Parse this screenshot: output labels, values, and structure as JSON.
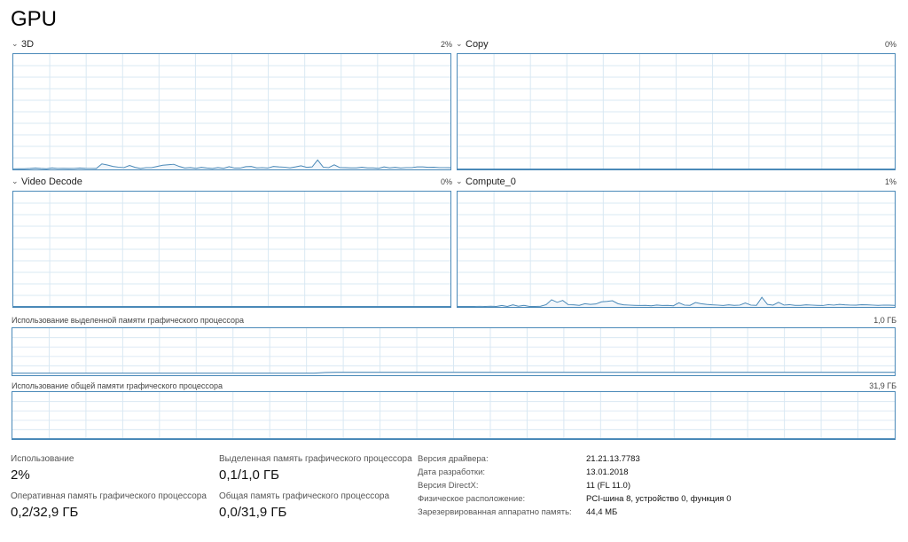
{
  "title": "GPU",
  "engines": [
    {
      "label": "3D",
      "pct": "2%",
      "values": [
        0.5,
        0.6,
        0.6,
        0.8,
        1.2,
        0.8,
        0.6,
        1.4,
        0.9,
        1.0,
        0.8,
        0.9,
        1.2,
        1.0,
        0.9,
        0.8,
        4.8,
        3.9,
        2.6,
        2.0,
        1.6,
        3.4,
        1.8,
        0.9,
        1.6,
        1.6,
        2.6,
        3.6,
        4.0,
        4.5,
        2.6,
        1.3,
        1.6,
        1.0,
        1.8,
        1.3,
        0.9,
        1.6,
        1.0,
        2.4,
        1.2,
        1.2,
        2.4,
        2.6,
        1.4,
        1.6,
        1.2,
        2.6,
        2.2,
        2.0,
        1.4,
        2.2,
        3.2,
        1.8,
        2.2,
        8.2,
        2.0,
        1.6,
        4.0,
        1.6,
        1.5,
        1.4,
        1.4,
        1.9,
        1.4,
        1.4,
        1.0,
        2.2,
        1.4,
        1.8,
        1.2,
        1.6,
        1.6,
        2.2,
        2.2,
        1.8,
        1.9,
        1.6,
        1.6,
        1.5
      ]
    },
    {
      "label": "Copy",
      "pct": "0%",
      "values": [
        0.1,
        0.1,
        0.1,
        0.1,
        0.1,
        0.1,
        0.1,
        0.1,
        0.2,
        0.1,
        0.1,
        0.1,
        0.1,
        0.1,
        0.1,
        0.1,
        0.1,
        0.1,
        0.1,
        0.1,
        0.1,
        0.1,
        0.1,
        0.1,
        0.1,
        0.1,
        0.1,
        0.1,
        0.1,
        0.1,
        0.1,
        0.1,
        0.1,
        0.1,
        0.1,
        0.1,
        0.1,
        0.1,
        0.1,
        0.1,
        0.1,
        0.1,
        0.1,
        0.1,
        0.1,
        0.1,
        0.1,
        0.1,
        0.1,
        0.1,
        0.1,
        0.1,
        0.1,
        0.1,
        0.1,
        0.1,
        0.1,
        0.1,
        0.1,
        0.1,
        0.1,
        0.2,
        0.1,
        0.1,
        0.1,
        0.1,
        0.1,
        0.1,
        0.1,
        0.1,
        0.1,
        0.1,
        0.1,
        0.1,
        0.1,
        0.1,
        0.1,
        0.1,
        0.1,
        0.1
      ]
    },
    {
      "label": "Video Decode",
      "pct": "0%",
      "values": [
        0,
        0,
        0,
        0,
        0,
        0,
        0,
        0,
        0,
        0,
        0,
        0,
        0,
        0,
        0,
        0,
        0,
        0,
        0,
        0,
        0,
        0,
        0,
        0,
        0,
        0,
        0,
        0,
        0,
        0,
        0,
        0,
        0,
        0,
        0,
        0,
        0,
        0,
        0,
        0,
        0,
        0,
        0,
        0,
        0,
        0,
        0,
        0,
        0,
        0,
        0,
        0,
        0,
        0,
        0,
        0,
        0,
        0,
        0,
        0,
        0,
        0,
        0,
        0,
        0,
        0,
        0,
        0,
        0,
        0,
        0,
        0,
        0,
        0,
        0,
        0,
        0,
        0,
        0,
        0
      ]
    },
    {
      "label": "Compute_0",
      "pct": "1%",
      "values": [
        0.3,
        0.4,
        0.3,
        0.4,
        0.5,
        0.3,
        0.6,
        0.3,
        1.2,
        0.4,
        1.8,
        0.6,
        1.4,
        0.4,
        0.4,
        0.6,
        2.0,
        6.2,
        4.0,
        5.6,
        2.0,
        1.8,
        1.4,
        2.8,
        2.2,
        2.6,
        4.4,
        4.8,
        5.4,
        2.8,
        1.8,
        1.6,
        1.4,
        1.2,
        1.4,
        1.0,
        1.6,
        1.2,
        1.4,
        1.0,
        3.6,
        1.6,
        1.4,
        3.8,
        2.8,
        2.2,
        1.8,
        1.6,
        1.2,
        1.8,
        1.4,
        1.6,
        3.4,
        1.6,
        1.4,
        8.4,
        2.2,
        1.6,
        4.0,
        1.6,
        2.0,
        1.4,
        1.4,
        1.8,
        1.6,
        1.4,
        1.2,
        2.0,
        1.6,
        2.2,
        1.8,
        1.6,
        1.5,
        1.9,
        1.8,
        1.6,
        1.4,
        1.6,
        1.5,
        1.4
      ]
    }
  ],
  "dedicated_mem": {
    "label": "Использование выделенной памяти графического процессора",
    "max": "1,0 ГБ",
    "values": [
      4.5,
      4.5,
      4.5,
      4.5,
      4.5,
      4.5,
      4.5,
      4.5,
      4.5,
      4.5,
      4.5,
      4.5,
      4.5,
      4.5,
      4.5,
      4.5,
      4.5,
      4.5,
      4.5,
      4.5,
      4.5,
      4.5,
      4.5,
      4.5,
      4.5,
      4.5,
      4.5,
      4.5,
      5.8,
      6.3,
      6.3,
      6.3,
      6.3,
      6.3,
      6.3,
      6.3,
      6.3,
      6.3,
      6.3,
      6.3,
      6.3,
      6.3,
      6.3,
      6.3,
      6.3,
      6.3,
      6.3,
      6.3,
      6.3,
      6.3,
      6.3,
      6.3,
      6.3,
      6.3,
      6.3,
      6.3,
      6.3,
      6.3,
      6.3,
      6.3,
      6.3,
      6.3,
      6.3,
      6.3,
      6.3,
      6.3,
      6.3,
      6.3,
      6.3,
      6.3,
      6.3,
      6.3,
      6.3,
      6.3,
      6.3,
      6.3,
      6.3,
      6.3,
      6.3,
      6.3
    ]
  },
  "shared_mem": {
    "label": "Использование общей памяти графического процессора",
    "max": "31,9 ГБ",
    "values": [
      0,
      0,
      0,
      0,
      0,
      0,
      0,
      0,
      0,
      0,
      0,
      0,
      0,
      0,
      0,
      0,
      0,
      0,
      0,
      0,
      0,
      0,
      0,
      0,
      0,
      0,
      0,
      0,
      0,
      0,
      0,
      0,
      0,
      0,
      0,
      0,
      0,
      0,
      0,
      0,
      0,
      0,
      0,
      0,
      0,
      0,
      0,
      0,
      0,
      0,
      0,
      0,
      0,
      0,
      0,
      0,
      0,
      0,
      0,
      0,
      0,
      0,
      0,
      0,
      0,
      0,
      0,
      0,
      0,
      0,
      0,
      0,
      0,
      0,
      0,
      0,
      0,
      0,
      0,
      0
    ]
  },
  "stats": {
    "usage_label": "Использование",
    "usage_value": "2%",
    "dedicated_label": "Выделенная память графического процессора",
    "dedicated_value": "0,1/1,0 ГБ",
    "gpu_ram_label": "Оперативная память графического процессора",
    "gpu_ram_value": "0,2/32,9 ГБ",
    "shared_label": "Общая память графического процессора",
    "shared_value": "0,0/31,9 ГБ"
  },
  "info": [
    {
      "key": "Версия драйвера:",
      "value": "21.21.13.7783"
    },
    {
      "key": "Дата разработки:",
      "value": "13.01.2018"
    },
    {
      "key": "Версия DirectX:",
      "value": "11 (FL 11.0)"
    },
    {
      "key": "Физическое расположение:",
      "value": "PCI-шина 8, устройство 0, функция 0"
    },
    {
      "key": "Зарезервированная аппаратно память:",
      "value": "44,4 МБ"
    }
  ],
  "colors": {
    "border": "#4a89b8",
    "grid": "#d9e8f3",
    "line": "#4a89b8",
    "fill": "#f1f6fb"
  }
}
